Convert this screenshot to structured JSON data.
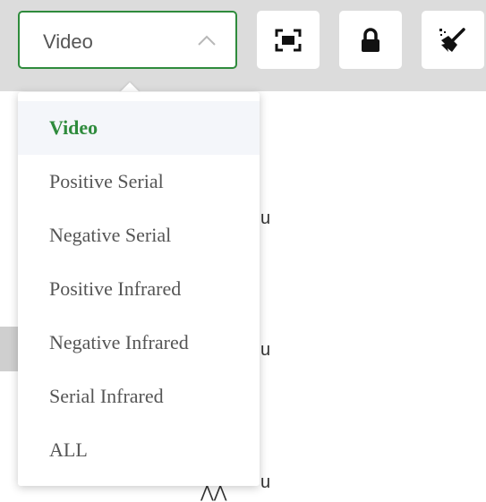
{
  "toolbar": {
    "select": {
      "value": "Video",
      "chevron_icon": "chevron-up-icon",
      "accent_color": "#2e8b3c"
    },
    "buttons": [
      {
        "name": "fullscreen-button",
        "icon": "fullscreen-icon"
      },
      {
        "name": "lock-button",
        "icon": "lock-icon"
      },
      {
        "name": "clear-button",
        "icon": "broom-icon"
      }
    ]
  },
  "dropdown": {
    "options": [
      "Video",
      "Positive Serial",
      "Negative Serial",
      "Positive Infrared",
      "Negative Infrared",
      "Serial Infrared",
      "ALL"
    ],
    "selected": "Video"
  }
}
